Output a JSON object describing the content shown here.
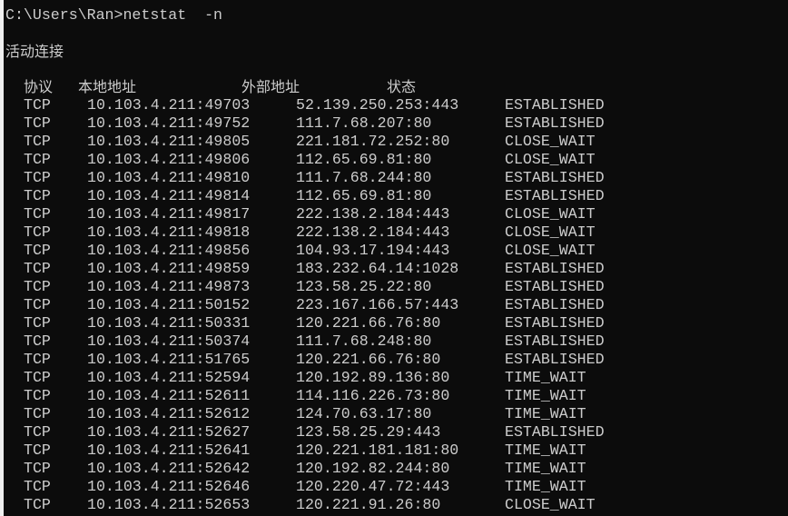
{
  "console": {
    "prompt": "C:\\Users\\Ran>netstat  -n",
    "section_title": "活动连接",
    "headers": [
      "协议",
      "本地地址",
      "外部地址",
      "状态"
    ],
    "rows": [
      [
        "TCP",
        "10.103.4.211:49703",
        "52.139.250.253:443",
        "ESTABLISHED"
      ],
      [
        "TCP",
        "10.103.4.211:49752",
        "111.7.68.207:80",
        "ESTABLISHED"
      ],
      [
        "TCP",
        "10.103.4.211:49805",
        "221.181.72.252:80",
        "CLOSE_WAIT"
      ],
      [
        "TCP",
        "10.103.4.211:49806",
        "112.65.69.81:80",
        "CLOSE_WAIT"
      ],
      [
        "TCP",
        "10.103.4.211:49810",
        "111.7.68.244:80",
        "ESTABLISHED"
      ],
      [
        "TCP",
        "10.103.4.211:49814",
        "112.65.69.81:80",
        "ESTABLISHED"
      ],
      [
        "TCP",
        "10.103.4.211:49817",
        "222.138.2.184:443",
        "CLOSE_WAIT"
      ],
      [
        "TCP",
        "10.103.4.211:49818",
        "222.138.2.184:443",
        "CLOSE_WAIT"
      ],
      [
        "TCP",
        "10.103.4.211:49856",
        "104.93.17.194:443",
        "CLOSE_WAIT"
      ],
      [
        "TCP",
        "10.103.4.211:49859",
        "183.232.64.14:1028",
        "ESTABLISHED"
      ],
      [
        "TCP",
        "10.103.4.211:49873",
        "123.58.25.22:80",
        "ESTABLISHED"
      ],
      [
        "TCP",
        "10.103.4.211:50152",
        "223.167.166.57:443",
        "ESTABLISHED"
      ],
      [
        "TCP",
        "10.103.4.211:50331",
        "120.221.66.76:80",
        "ESTABLISHED"
      ],
      [
        "TCP",
        "10.103.4.211:50374",
        "111.7.68.248:80",
        "ESTABLISHED"
      ],
      [
        "TCP",
        "10.103.4.211:51765",
        "120.221.66.76:80",
        "ESTABLISHED"
      ],
      [
        "TCP",
        "10.103.4.211:52594",
        "120.192.89.136:80",
        "TIME_WAIT"
      ],
      [
        "TCP",
        "10.103.4.211:52611",
        "114.116.226.73:80",
        "TIME_WAIT"
      ],
      [
        "TCP",
        "10.103.4.211:52612",
        "124.70.63.17:80",
        "TIME_WAIT"
      ],
      [
        "TCP",
        "10.103.4.211:52627",
        "123.58.25.29:443",
        "ESTABLISHED"
      ],
      [
        "TCP",
        "10.103.4.211:52641",
        "120.221.181.181:80",
        "TIME_WAIT"
      ],
      [
        "TCP",
        "10.103.4.211:52642",
        "120.192.82.244:80",
        "TIME_WAIT"
      ],
      [
        "TCP",
        "10.103.4.211:52646",
        "120.220.47.72:443",
        "TIME_WAIT"
      ],
      [
        "TCP",
        "10.103.4.211:52653",
        "120.221.91.26:80",
        "CLOSE_WAIT"
      ]
    ]
  },
  "colors": {
    "background": "#0c0c0c",
    "text": "#cccccc"
  }
}
